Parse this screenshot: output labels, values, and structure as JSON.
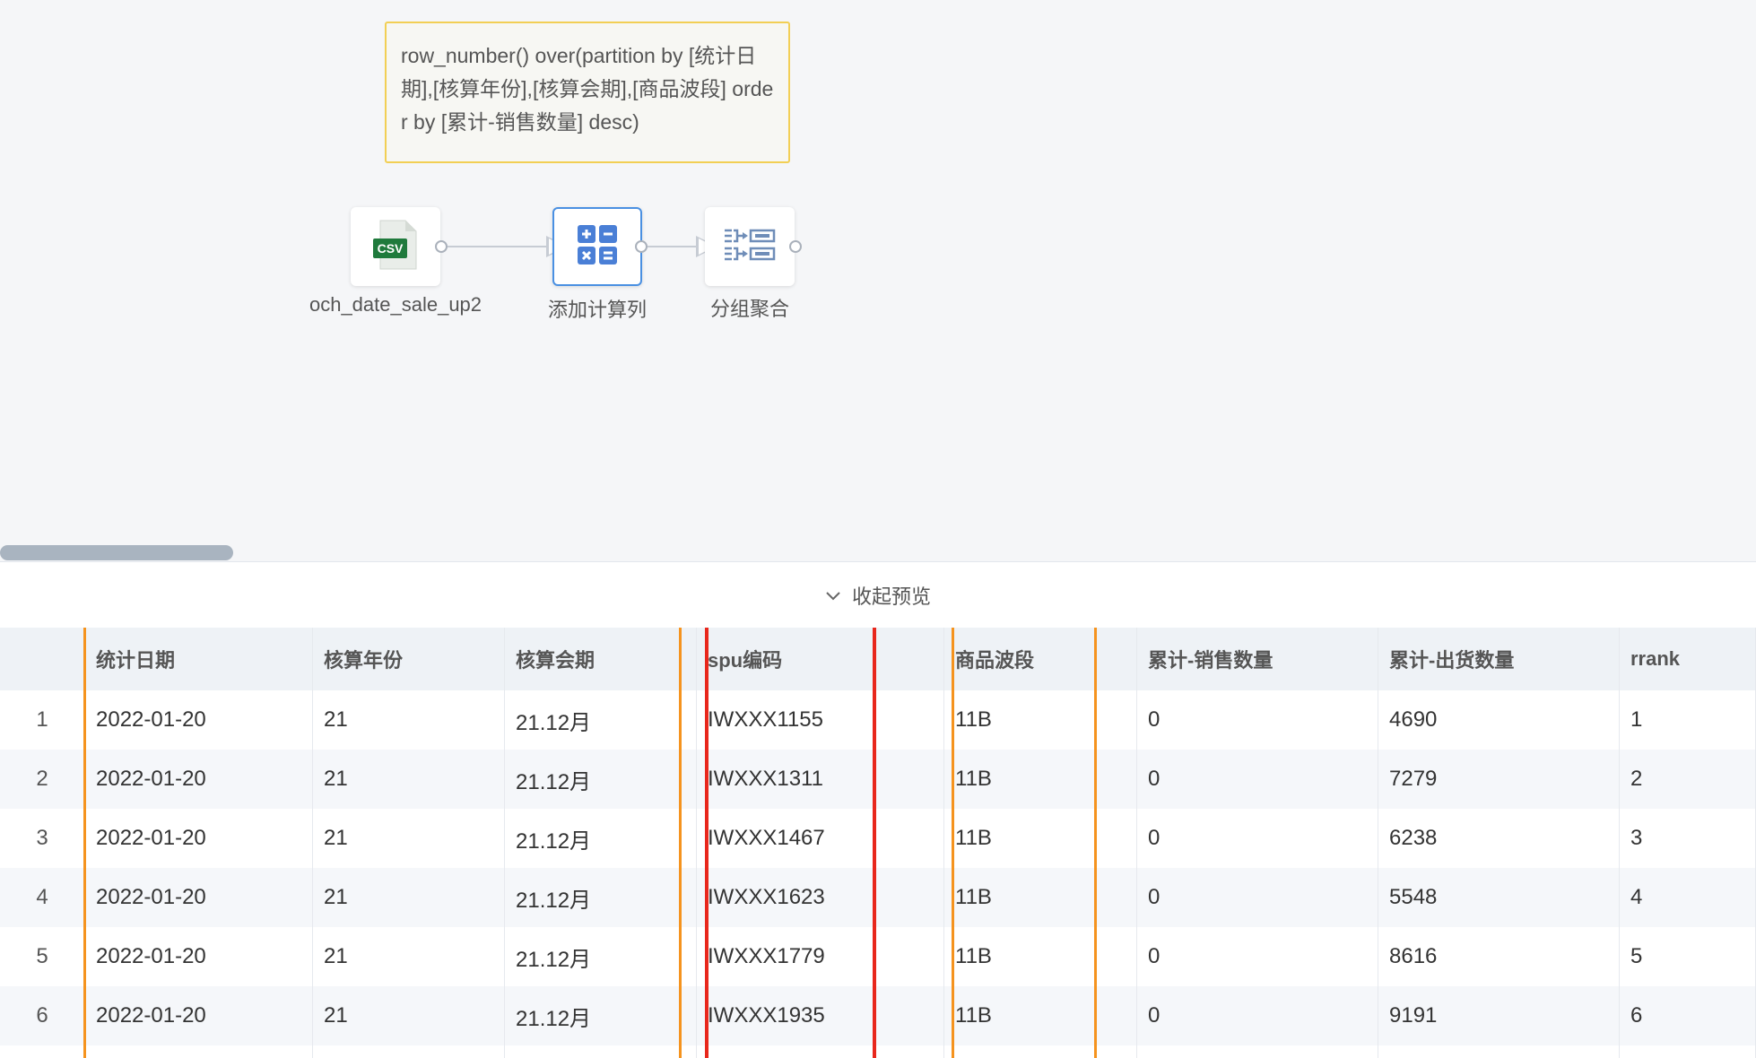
{
  "note": {
    "text": "row_number() over(partition by [统计日期],[核算年份],[核算会期],[商品波段] order by [累计-销售数量] desc)"
  },
  "nodes": [
    {
      "label": "och_date_sale_up2",
      "icon": "csv-file-icon",
      "badge": "CSV"
    },
    {
      "label": "添加计算列",
      "icon": "calculator-icon"
    },
    {
      "label": "分组聚合",
      "icon": "group-aggregate-icon"
    }
  ],
  "preview": {
    "toggle_label": "收起预览",
    "icon": "chevron-down-icon"
  },
  "table": {
    "columns": [
      "",
      "统计日期",
      "核算年份",
      "核算会期",
      "spu编码",
      "商品波段",
      "累计-销售数量",
      "累计-出货数量",
      "rrank"
    ],
    "rows": [
      [
        "1",
        "2022-01-20",
        "21",
        "21.12月",
        "IWXXX1155",
        "11B",
        "0",
        "4690",
        "1"
      ],
      [
        "2",
        "2022-01-20",
        "21",
        "21.12月",
        "IWXXX1311",
        "11B",
        "0",
        "7279",
        "2"
      ],
      [
        "3",
        "2022-01-20",
        "21",
        "21.12月",
        "IWXXX1467",
        "11B",
        "0",
        "6238",
        "3"
      ],
      [
        "4",
        "2022-01-20",
        "21",
        "21.12月",
        "IWXXX1623",
        "11B",
        "0",
        "5548",
        "4"
      ],
      [
        "5",
        "2022-01-20",
        "21",
        "21.12月",
        "IWXXX1779",
        "11B",
        "0",
        "8616",
        "5"
      ],
      [
        "6",
        "2022-01-20",
        "21",
        "21.12月",
        "IWXXX1935",
        "11B",
        "0",
        "9191",
        "6"
      ],
      [
        "",
        "",
        "",
        "",
        "",
        "",
        "",
        "",
        ""
      ]
    ]
  },
  "colors": {
    "highlight_orange": "#f5931e",
    "highlight_red": "#e8271c",
    "selected_node": "#4a90e2",
    "note_border": "#f2cf55"
  }
}
